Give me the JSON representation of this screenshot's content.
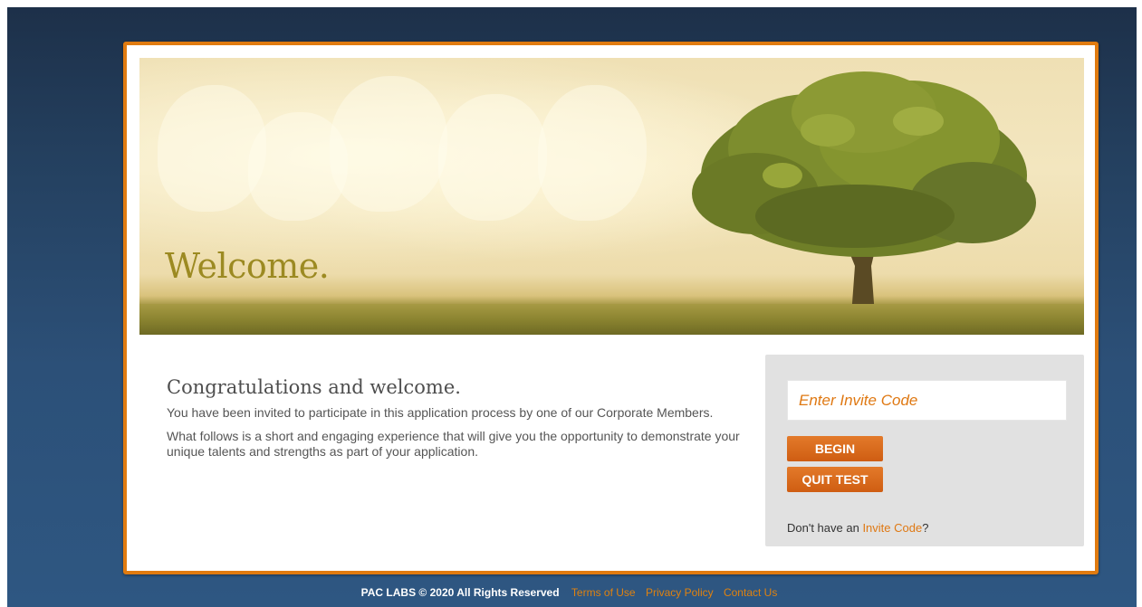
{
  "hero": {
    "title": "Welcome."
  },
  "main": {
    "title": "Congratulations and welcome.",
    "paragraphs": [
      "You have been invited to participate in this application process by one of our Corporate Members.",
      "What follows is a short and engaging experience that will give you the opportunity to demonstrate your unique talents and strengths as part of your application."
    ]
  },
  "invite_panel": {
    "input_placeholder": "Enter Invite Code",
    "input_value": "",
    "begin_label": "BEGIN",
    "quit_label": "QUIT TEST",
    "no_code_prefix": "Don't have an ",
    "no_code_link": "Invite Code",
    "no_code_suffix": "?"
  },
  "footer": {
    "copyright": "PAC LABS © 2020 All Rights Reserved",
    "links": [
      "Terms of Use",
      "Privacy Policy",
      "Contact Us"
    ]
  },
  "colors": {
    "accent_orange": "#e07b10",
    "button_orange": "#d3621a",
    "background_blue": "#2c5078",
    "hero_title": "#9c8a22"
  }
}
